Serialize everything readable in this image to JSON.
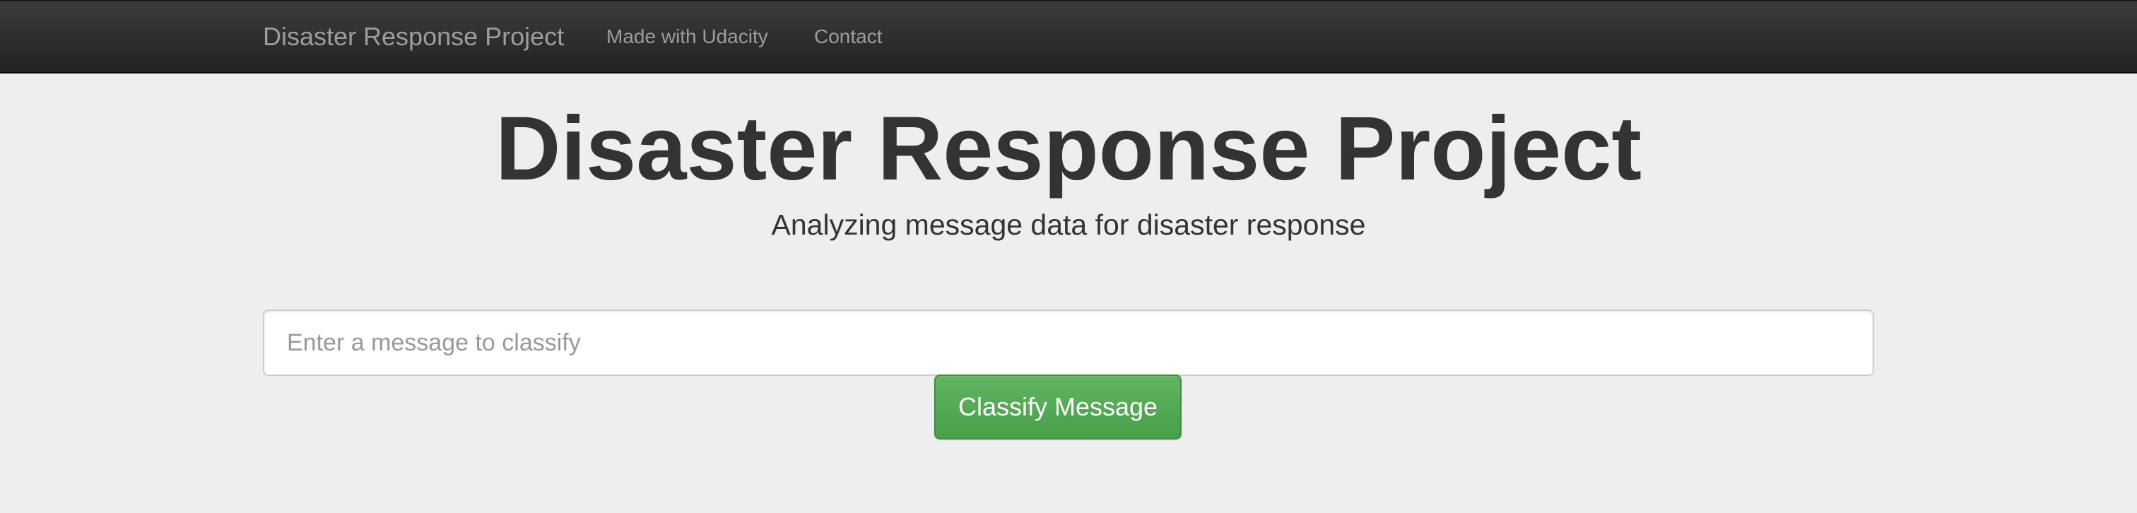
{
  "navbar": {
    "brand": "Disaster Response Project",
    "links": [
      {
        "label": "Made with Udacity"
      },
      {
        "label": "Contact"
      }
    ]
  },
  "jumbotron": {
    "title": "Disaster Response Project",
    "subtitle": "Analyzing message data for disaster response"
  },
  "form": {
    "query_placeholder": "Enter a message to classify",
    "query_value": "",
    "submit_label": "Classify Message"
  },
  "colors": {
    "navbar_background": "#222222",
    "navbar_text": "#9d9d9d",
    "page_background": "#eeeeee",
    "heading_text": "#333333",
    "button_background": "#5cb85c",
    "button_text": "#ffffff"
  }
}
